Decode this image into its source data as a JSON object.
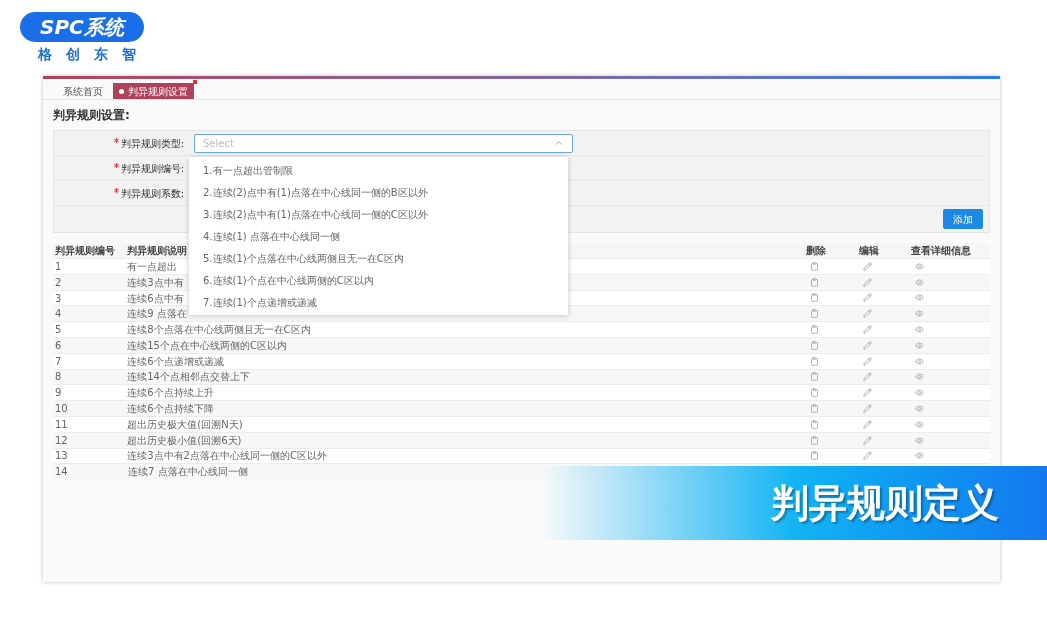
{
  "logo": {
    "title": "SPC系统",
    "subtitle": "格创东智"
  },
  "tabs": [
    {
      "label": "系统首页",
      "selected": false
    },
    {
      "label": "判异规则设置",
      "selected": true
    }
  ],
  "form": {
    "title": "判异规则设置:",
    "fields": [
      {
        "label": "判异规则类型:",
        "required": true,
        "placeholder": "Select",
        "open": true
      },
      {
        "label": "判异规则编号:",
        "required": true
      },
      {
        "label": "判异规则系数:",
        "required": true
      }
    ],
    "add_button": "添加"
  },
  "dropdown": {
    "options": [
      "1.有一点超出管制限",
      "2.连续(2)点中有(1)点落在中心线同一侧的B区以外",
      "3.连续(2)点中有(1)点落在中心线同一侧的C区以外",
      "4.连续(1) 点落在中心线同一侧",
      "5.连续(1)个点落在中心线两侧且无一在C区内",
      "6.连续(1)个点在中心线两侧的C区以内",
      "7.连续(1)个点递增或递减"
    ]
  },
  "table": {
    "columns": [
      "判异规则编号",
      "判异规则说明",
      "删除",
      "编辑",
      "查看详细信息"
    ],
    "rows": [
      {
        "number": "1",
        "description": "有一点超出",
        "actions": true
      },
      {
        "number": "2",
        "description": "连续3点中有",
        "actions": true
      },
      {
        "number": "3",
        "description": "连续6点中有",
        "actions": true
      },
      {
        "number": "4",
        "description": "连续9 点落在",
        "actions": true
      },
      {
        "number": "5",
        "description": "连续8个点落在中心线两侧且无一在C区内",
        "actions": true
      },
      {
        "number": "6",
        "description": "连续15个点在中心线两侧的C区以内",
        "actions": true
      },
      {
        "number": "7",
        "description": "连续6个点递增或递减",
        "actions": true
      },
      {
        "number": "8",
        "description": "连续14个点相邻点交替上下",
        "actions": true
      },
      {
        "number": "9",
        "description": "连续6个点持续上升",
        "actions": true
      },
      {
        "number": "10",
        "description": "连续6个点持续下降",
        "actions": true
      },
      {
        "number": "11",
        "description": "超出历史极大值(回溯N天)",
        "actions": true
      },
      {
        "number": "12",
        "description": "超出历史极小值(回溯6天)",
        "actions": true
      },
      {
        "number": "13",
        "description": "连续3点中有2点落在中心线同一侧的C区以外",
        "actions": true
      },
      {
        "number": "14",
        "description": "连续7 点落在中心线同一侧",
        "actions": false
      }
    ]
  },
  "banner": {
    "text": "判异规则定义"
  }
}
